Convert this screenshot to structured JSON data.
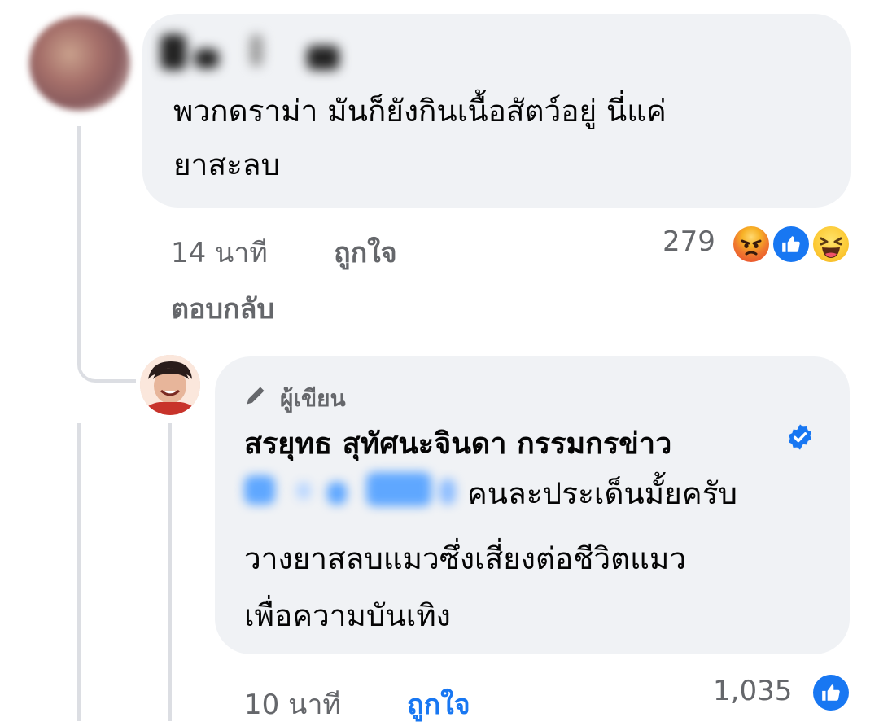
{
  "comment1": {
    "text": "พวกดราม่า มันก็ยังกินเนื้อสัตว์อยู่ นี่แค่\nยาสะลบ",
    "time": "14 นาที",
    "like_label": "ถูกใจ",
    "reply_label": "ตอบกลับ",
    "reaction_count": "279",
    "reactions": [
      "angry-icon",
      "like-icon",
      "haha-icon"
    ]
  },
  "reply": {
    "badge_label": "ผู้เขียน",
    "author": "สรยุทธ สุทัศนะจินดา กรรมกรข่าว",
    "text_after_tag": "คนละประเด็นมั้ยครับ",
    "text_rest": "วางยาสลบแมวซึ่งเสี่ยงต่อชีวิตแมว\nเพื่อความบันเทิง",
    "time": "10 นาที",
    "like_label": "ถูกใจ",
    "reaction_count": "1,035",
    "reactions": [
      "like-icon"
    ]
  },
  "colors": {
    "bubble": "#f0f2f5",
    "meta_text": "#65676b",
    "accent_blue": "#1877f2",
    "thread_line": "#dcdee3"
  }
}
